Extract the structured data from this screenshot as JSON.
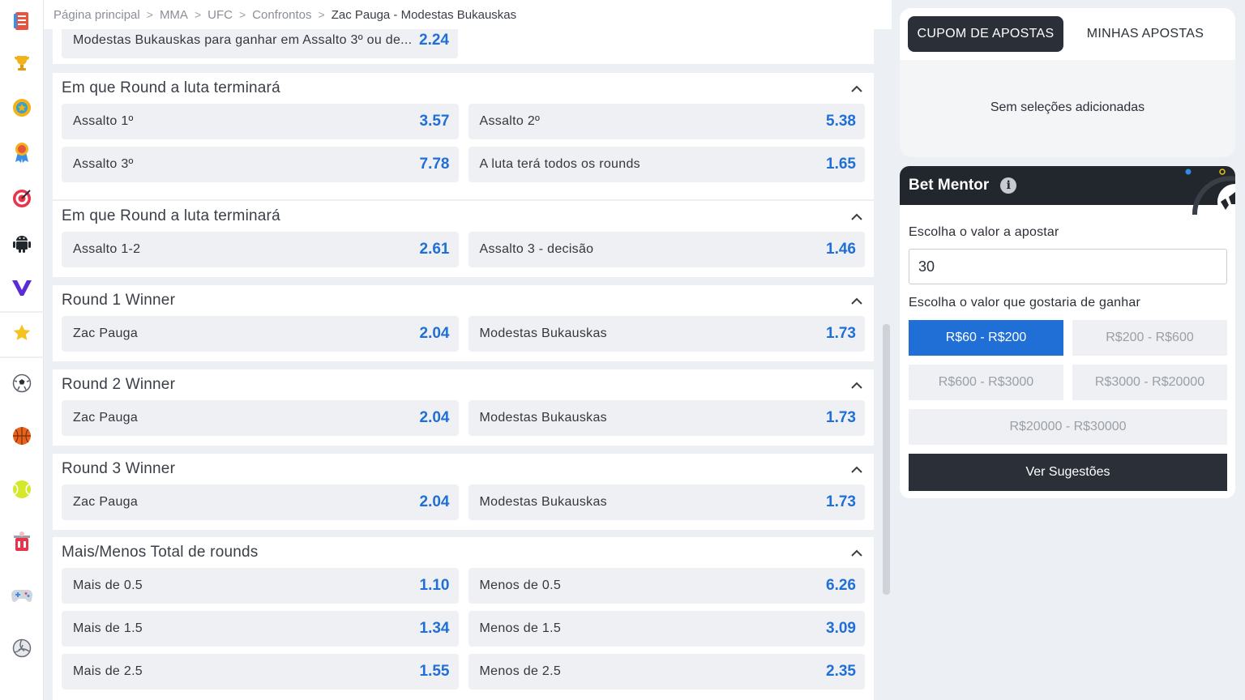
{
  "breadcrumb": {
    "items": [
      "Página principal",
      "MMA",
      "UFC",
      "Confrontos",
      "Zac Pauga - Modestas Bukauskas"
    ]
  },
  "rail_icons": [
    "betslip-icon",
    "trophy-icon",
    "medal-icon",
    "award-icon",
    "target-icon",
    "android-icon",
    "v-logo-icon",
    "star-icon",
    "soccer-icon",
    "basketball-icon",
    "tennis-icon",
    "table-football-icon",
    "gamepad-icon",
    "volleyball-icon"
  ],
  "markets": [
    {
      "title": "",
      "partial_top": true,
      "rows": [
        [
          {
            "label": "Modestas Bukauskas para ganhar em Assalto 3º ou de...",
            "odd": "2.24"
          }
        ]
      ]
    },
    {
      "title": "Em que Round a luta terminará",
      "rows": [
        [
          {
            "label": "Assalto 1º",
            "odd": "3.57"
          },
          {
            "label": "Assalto 2º",
            "odd": "5.38"
          }
        ],
        [
          {
            "label": "Assalto 3º",
            "odd": "7.78"
          },
          {
            "label": "A luta terá todos os rounds",
            "odd": "1.65"
          }
        ]
      ]
    },
    {
      "title": "Em que Round a luta terminará",
      "rows": [
        [
          {
            "label": "Assalto 1-2",
            "odd": "2.61"
          },
          {
            "label": "Assalto 3 - decisão",
            "odd": "1.46"
          }
        ]
      ]
    },
    {
      "title": "Round 1 Winner",
      "rows": [
        [
          {
            "label": "Zac Pauga",
            "odd": "2.04"
          },
          {
            "label": "Modestas Bukauskas",
            "odd": "1.73"
          }
        ]
      ]
    },
    {
      "title": "Round 2 Winner",
      "rows": [
        [
          {
            "label": "Zac Pauga",
            "odd": "2.04"
          },
          {
            "label": "Modestas Bukauskas",
            "odd": "1.73"
          }
        ]
      ]
    },
    {
      "title": "Round 3 Winner",
      "rows": [
        [
          {
            "label": "Zac Pauga",
            "odd": "2.04"
          },
          {
            "label": "Modestas Bukauskas",
            "odd": "1.73"
          }
        ]
      ]
    },
    {
      "title": "Mais/Menos Total de rounds",
      "rows": [
        [
          {
            "label": "Mais de 0.5",
            "odd": "1.10"
          },
          {
            "label": "Menos de 0.5",
            "odd": "6.26"
          }
        ],
        [
          {
            "label": "Mais de 1.5",
            "odd": "1.34"
          },
          {
            "label": "Menos de 1.5",
            "odd": "3.09"
          }
        ],
        [
          {
            "label": "Mais de 2.5",
            "odd": "1.55"
          },
          {
            "label": "Menos de 2.5",
            "odd": "2.35"
          }
        ]
      ]
    }
  ],
  "betslip": {
    "tab_active": "CUPOM DE APOSTAS",
    "tab_inactive": "MINHAS APOSTAS",
    "empty_text": "Sem seleções adicionadas"
  },
  "mentor": {
    "title": "Bet Mentor",
    "info_glyph": "i",
    "stake_label": "Escolha o valor a apostar",
    "stake_value": "30",
    "win_label": "Escolha o valor que gostaria de ganhar",
    "ranges": [
      "R$60 - R$200",
      "R$200 - R$600",
      "R$600 - R$3000",
      "R$3000 - R$20000",
      "R$20000 - R$30000"
    ],
    "selected_range": "R$60 - R$200",
    "cta": "Ver Sugestões"
  },
  "colors": {
    "accent_blue": "#1f6fd6",
    "dark": "#2b3038",
    "odd_bg": "#eef0f3"
  }
}
